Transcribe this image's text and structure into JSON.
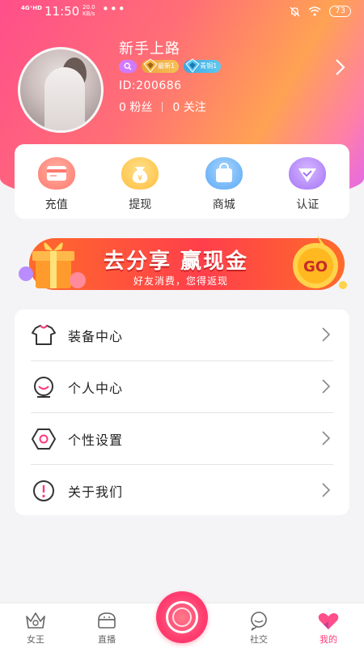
{
  "status_bar": {
    "signal": "4G⁺HD",
    "time": "11:50",
    "speed_value": "20.0",
    "speed_unit": "KB/s",
    "dots": "•••",
    "battery": "73"
  },
  "profile": {
    "username": "新手上路",
    "badge_gold": "最新1",
    "badge_blue": "青铜1",
    "user_id": "ID:200686",
    "fans": "0 粉丝",
    "following": "0 关注"
  },
  "quick_actions": [
    {
      "label": "充值",
      "icon": "card-icon",
      "color": "#ff7f7f"
    },
    {
      "label": "提现",
      "icon": "money-bag-icon",
      "color": "#ffc64a"
    },
    {
      "label": "商城",
      "icon": "shopping-bag-icon",
      "color": "#6ab5ff"
    },
    {
      "label": "认证",
      "icon": "diamond-icon",
      "color": "#b07cff"
    }
  ],
  "banner": {
    "title": "去分享 赢现金",
    "subtitle": "好友消费，您得返现",
    "go_label": "GO"
  },
  "menu": [
    {
      "label": "装备中心",
      "icon": "tshirt-icon"
    },
    {
      "label": "个人中心",
      "icon": "person-icon"
    },
    {
      "label": "个性设置",
      "icon": "hexagon-settings-icon"
    },
    {
      "label": "关于我们",
      "icon": "info-exclamation-icon"
    }
  ],
  "bottom_nav": [
    {
      "label": "女王",
      "icon": "queen-icon"
    },
    {
      "label": "直播",
      "icon": "live-cake-icon"
    },
    {
      "label": "社交",
      "icon": "social-chat-icon"
    },
    {
      "label": "我的",
      "icon": "heart-mine-icon",
      "active": true
    }
  ],
  "colors": {
    "accent": "#ff3a78",
    "header_gradient_start": "#ff4f8a",
    "header_gradient_end": "#e066f0"
  }
}
